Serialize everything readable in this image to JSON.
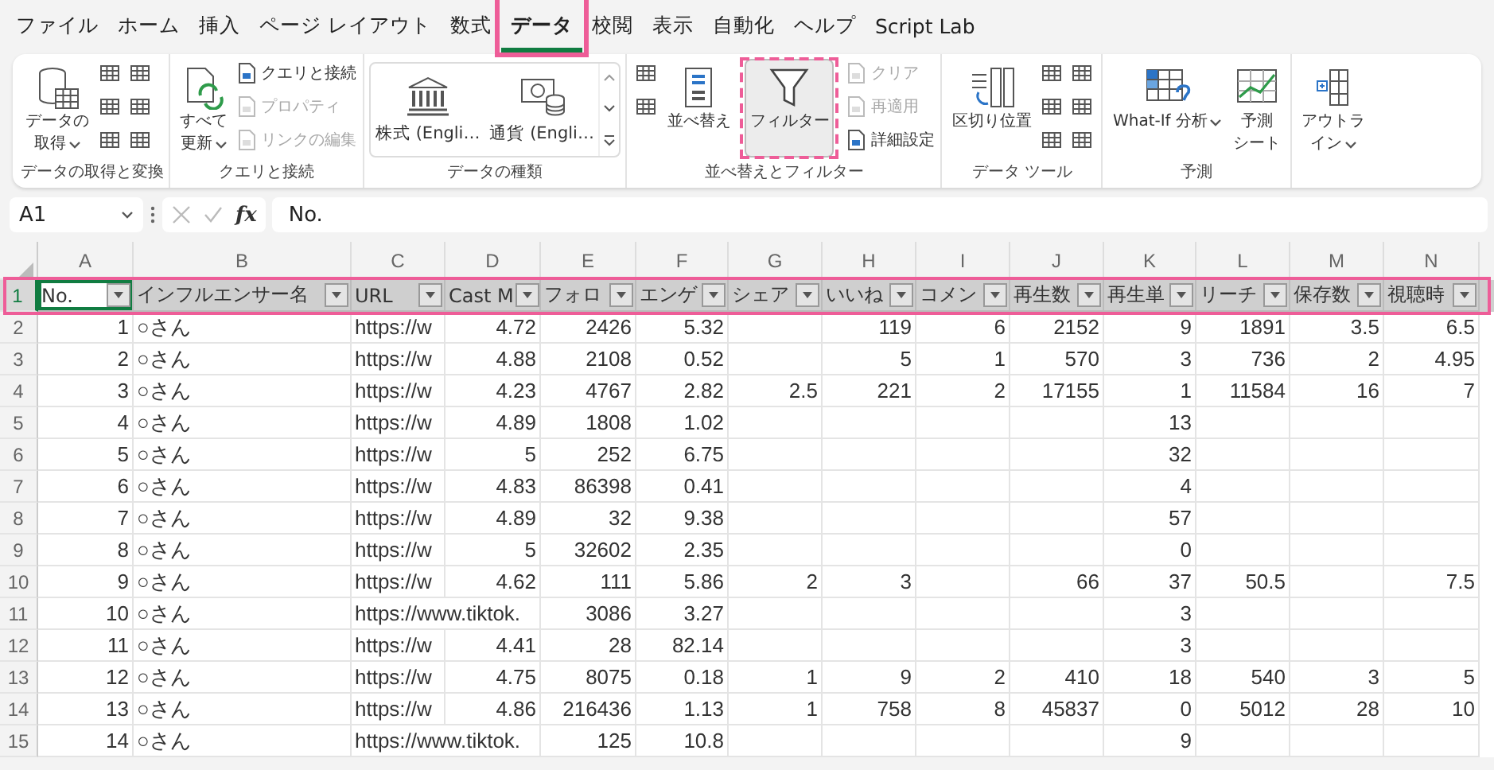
{
  "tabs": [
    {
      "label": "ファイル",
      "selected": false,
      "highlighted": false
    },
    {
      "label": "ホーム",
      "selected": false,
      "highlighted": false
    },
    {
      "label": "挿入",
      "selected": false,
      "highlighted": false
    },
    {
      "label": "ページ レイアウト",
      "selected": false,
      "highlighted": false
    },
    {
      "label": "数式",
      "selected": false,
      "highlighted": false
    },
    {
      "label": "データ",
      "selected": true,
      "highlighted": true
    },
    {
      "label": "校閲",
      "selected": false,
      "highlighted": false
    },
    {
      "label": "表示",
      "selected": false,
      "highlighted": false
    },
    {
      "label": "自動化",
      "selected": false,
      "highlighted": false
    },
    {
      "label": "ヘルプ",
      "selected": false,
      "highlighted": false
    },
    {
      "label": "Script Lab",
      "selected": false,
      "highlighted": false
    }
  ],
  "ribbon": {
    "groups": [
      {
        "label": "データの取得と変換",
        "items": [
          {
            "kind": "large",
            "lines": [
              "データの",
              "取得"
            ],
            "caret": true,
            "disabled": false,
            "selected": false
          },
          {
            "kind": "icon"
          },
          {
            "kind": "icon"
          },
          {
            "kind": "icon"
          },
          {
            "kind": "icon"
          },
          {
            "kind": "icon"
          },
          {
            "kind": "icon"
          }
        ]
      },
      {
        "label": "クエリと接続",
        "items": [
          {
            "kind": "large",
            "lines": [
              "すべて",
              "更新"
            ],
            "caret": true,
            "disabled": false,
            "selected": false
          },
          {
            "kind": "small",
            "label": "クエリと接続",
            "disabled": false
          },
          {
            "kind": "small",
            "label": "プロパティ",
            "disabled": true
          },
          {
            "kind": "small",
            "label": "リンクの編集",
            "disabled": true
          }
        ]
      },
      {
        "label": "データの種類",
        "items": [
          {
            "kind": "gallery",
            "entries": [
              "株式 (Engli…",
              "通貨 (Engli…"
            ]
          }
        ]
      },
      {
        "label": "並べ替えとフィルター",
        "items": [
          {
            "kind": "icon"
          },
          {
            "kind": "icon"
          },
          {
            "kind": "large",
            "lines": [
              "並べ替え"
            ],
            "caret": false,
            "disabled": false,
            "selected": false
          },
          {
            "kind": "large",
            "lines": [
              "フィルター"
            ],
            "caret": false,
            "disabled": false,
            "selected": true,
            "highlighted": true
          },
          {
            "kind": "small",
            "label": "クリア",
            "disabled": true
          },
          {
            "kind": "small",
            "label": "再適用",
            "disabled": true
          },
          {
            "kind": "small",
            "label": "詳細設定",
            "disabled": false
          }
        ]
      },
      {
        "label": "データ ツール",
        "items": [
          {
            "kind": "large",
            "lines": [
              "区切り位置"
            ],
            "caret": false,
            "disabled": false,
            "selected": false
          },
          {
            "kind": "icon"
          },
          {
            "kind": "icon"
          },
          {
            "kind": "icon"
          },
          {
            "kind": "icon"
          },
          {
            "kind": "icon"
          },
          {
            "kind": "icon"
          }
        ]
      },
      {
        "label": "予測",
        "items": [
          {
            "kind": "large",
            "lines": [
              "What-If 分析"
            ],
            "caret": true,
            "disabled": false,
            "selected": false
          },
          {
            "kind": "large",
            "lines": [
              "予測",
              "シート"
            ],
            "caret": false,
            "disabled": false,
            "selected": false
          }
        ]
      },
      {
        "items": [
          {
            "kind": "large",
            "lines": [
              "アウトラ",
              "イン"
            ],
            "caret": true,
            "disabled": false,
            "selected": false
          }
        ]
      }
    ]
  },
  "formula_bar": {
    "name_box": "A1",
    "function_label": "fx",
    "value": "No."
  },
  "sheet": {
    "columns": [
      "A",
      "B",
      "C",
      "D",
      "E",
      "F",
      "G",
      "H",
      "I",
      "J",
      "K",
      "L",
      "M",
      "N"
    ],
    "header_row": {
      "number": "1",
      "selected": true,
      "highlighted": true,
      "cells": [
        {
          "text": "No.",
          "filter": true,
          "active": true
        },
        {
          "text": "インフルエンサー名",
          "filter": true,
          "active": false
        },
        {
          "text": "URL",
          "filter": true,
          "active": false
        },
        {
          "text": "Cast M",
          "filter": true,
          "active": false
        },
        {
          "text": "フォロ",
          "filter": true,
          "active": false
        },
        {
          "text": "エンゲ",
          "filter": true,
          "active": false
        },
        {
          "text": "シェア",
          "filter": true,
          "active": false
        },
        {
          "text": "いいね",
          "filter": true,
          "active": false
        },
        {
          "text": "コメン",
          "filter": true,
          "active": false
        },
        {
          "text": "再生数",
          "filter": true,
          "active": false
        },
        {
          "text": "再生単",
          "filter": true,
          "active": false
        },
        {
          "text": "リーチ",
          "filter": true,
          "active": false
        },
        {
          "text": "保存数",
          "filter": true,
          "active": false
        },
        {
          "text": "視聴時",
          "filter": true,
          "active": false
        }
      ]
    },
    "rows": [
      {
        "number": "2",
        "cells": [
          "1",
          "○さん",
          "https://w",
          "4.72",
          "2426",
          "5.32",
          null,
          "119",
          "6",
          "2152",
          "9",
          "1891",
          "3.5",
          "6.5"
        ]
      },
      {
        "number": "3",
        "cells": [
          "2",
          "○さん",
          "https://w",
          "4.88",
          "2108",
          "0.52",
          null,
          "5",
          "1",
          "570",
          "3",
          "736",
          "2",
          "4.95"
        ]
      },
      {
        "number": "4",
        "cells": [
          "3",
          "○さん",
          "https://w",
          "4.23",
          "4767",
          "2.82",
          "2.5",
          "221",
          "2",
          "17155",
          "1",
          "11584",
          "16",
          "7"
        ]
      },
      {
        "number": "5",
        "cells": [
          "4",
          "○さん",
          "https://w",
          "4.89",
          "1808",
          "1.02",
          null,
          null,
          null,
          null,
          "13",
          null,
          null,
          null
        ]
      },
      {
        "number": "6",
        "cells": [
          "5",
          "○さん",
          "https://w",
          "5",
          "252",
          "6.75",
          null,
          null,
          null,
          null,
          "32",
          null,
          null,
          null
        ]
      },
      {
        "number": "7",
        "cells": [
          "6",
          "○さん",
          "https://w",
          "4.83",
          "86398",
          "0.41",
          null,
          null,
          null,
          null,
          "4",
          null,
          null,
          null
        ]
      },
      {
        "number": "8",
        "cells": [
          "7",
          "○さん",
          "https://w",
          "4.89",
          "32",
          "9.38",
          null,
          null,
          null,
          null,
          "57",
          null,
          null,
          null
        ]
      },
      {
        "number": "9",
        "cells": [
          "8",
          "○さん",
          "https://w",
          "5",
          "32602",
          "2.35",
          null,
          null,
          null,
          null,
          "0",
          null,
          null,
          null
        ]
      },
      {
        "number": "10",
        "cells": [
          "9",
          "○さん",
          "https://w",
          "4.62",
          "111",
          "5.86",
          "2",
          "3",
          null,
          "66",
          "37",
          "50.5",
          null,
          "7.5"
        ]
      },
      {
        "number": "11",
        "cells": [
          "10",
          "○さん",
          "https://www.tiktok.",
          null,
          "3086",
          "3.27",
          null,
          null,
          null,
          null,
          "3",
          null,
          null,
          null
        ]
      },
      {
        "number": "12",
        "cells": [
          "11",
          "○さん",
          "https://w",
          "4.41",
          "28",
          "82.14",
          null,
          null,
          null,
          null,
          "3",
          null,
          null,
          null
        ]
      },
      {
        "number": "13",
        "cells": [
          "12",
          "○さん",
          "https://w",
          "4.75",
          "8075",
          "0.18",
          "1",
          "9",
          "2",
          "410",
          "18",
          "540",
          "3",
          "5"
        ]
      },
      {
        "number": "14",
        "cells": [
          "13",
          "○さん",
          "https://w",
          "4.86",
          "216436",
          "1.13",
          "1",
          "758",
          "8",
          "45837",
          "0",
          "5012",
          "28",
          "10"
        ]
      },
      {
        "number": "15",
        "cells": [
          "14",
          "○さん",
          "https://www.tiktok.",
          null,
          "125",
          "10.8",
          null,
          null,
          null,
          null,
          "9",
          null,
          null,
          null
        ]
      }
    ]
  }
}
